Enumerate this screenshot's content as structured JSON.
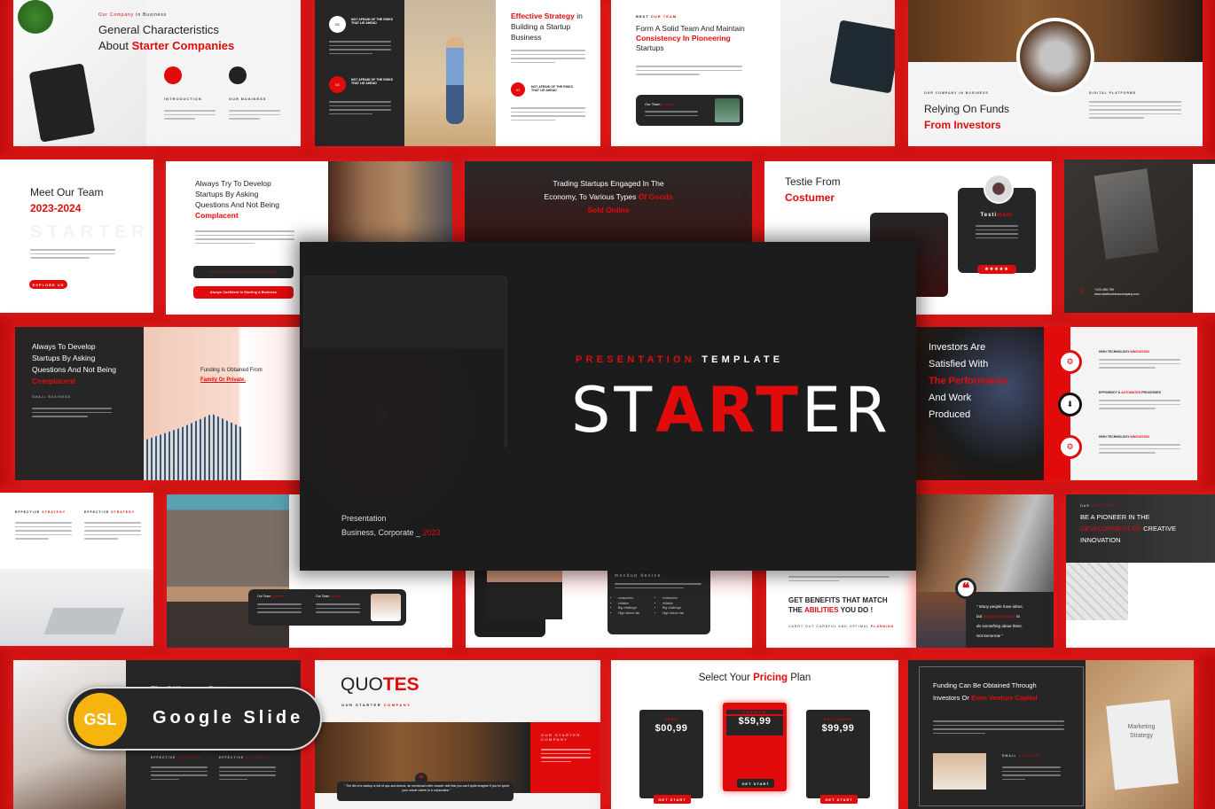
{
  "colors": {
    "accent": "#e10b0b",
    "dark": "#262626",
    "badge": "#f6b40e",
    "background": "#c00d0d"
  },
  "hero": {
    "subtitle_red": "PRESENTATION",
    "subtitle_white": "TEMPLATE",
    "title_part1": "ST",
    "title_part2": "ART",
    "title_part3": "ER",
    "footer_line1": "Presentation",
    "footer_line2": "Business, Corporate _",
    "footer_year": "2023"
  },
  "badge": {
    "short": "GSL",
    "label": "Google Slide"
  },
  "slides": {
    "general": {
      "kicker_red": "Our Company",
      "kicker": "In Business",
      "title1": "General Characteristics",
      "title2_dark": "About",
      "title2_red": "Starter Companies",
      "col1": "INTRODUCTION",
      "col2": "OUR BUSINESS"
    },
    "strategy": {
      "item_a": "02",
      "item_b": "03",
      "item_c": "01",
      "item_label": "NOT AFRAID OF THE RISKS THAT LIE AHEAD",
      "title_red": "Effective Strategy",
      "title_rest": "in",
      "title2": "Building a Startup",
      "title3": "Business"
    },
    "team_form": {
      "kicker_dark": "BEST",
      "kicker_red": "OUR TEAM",
      "title1": "Form A Solid Team And Maintain",
      "title2": "Consistency In Pioneering",
      "title3": "Startups",
      "card_title": "Our Team",
      "card_title_red": "Founder"
    },
    "relying": {
      "kicker": "OUR COMPANY IN BUSINESS",
      "title1": "Relying On Funds",
      "title2": "From Investors",
      "side": "DIGITAL PLATFORMS"
    },
    "meet": {
      "title": "Meet Our Team",
      "years": "2023-2024",
      "watermark": "STARTER",
      "button": "EXPLORE US"
    },
    "always": {
      "l1": "Always Try To Develop",
      "l2": "Startups By Asking",
      "l3": "Questions And Not Being",
      "l4": "Complacent",
      "btn1": "Discipline And Confidence In A Business",
      "btn2": "Always Confident In Starting A Business"
    },
    "trading": {
      "l1": "Trading Startups Engaged In The",
      "l2a": "Economy, To Various Types",
      "l2b": "Of Goods",
      "l3": "Sold Online"
    },
    "testie": {
      "title1": "Testie From",
      "title2": "Costumer",
      "card_a": "Testi",
      "card_b": "moni",
      "stars": "★★★★★"
    },
    "contact": {
      "phone": "+123-456-789",
      "web": "www.startbusinesscompany.com"
    },
    "always_dark": {
      "l1": "Always To Develop",
      "l2": "Startups By Asking",
      "l3": "Questions And Not Being",
      "l4": "Complacent",
      "kicker": "SMALL BUSINESS",
      "right1": "Funding Is Obtained From",
      "right2": "Family Or Private."
    },
    "investors": {
      "l1": "Investors Are",
      "l2": "Satisfied With",
      "l3": "The Performance",
      "l4": "And Work",
      "l5": "Produced",
      "item1": "HIGH TECHNOLOGY",
      "item1_red": "INNOVATION",
      "item2": "EFFICIENCY &",
      "item2_red": "AUTOMATED",
      "item2_rest": "PROCESSES",
      "item3": "HIGH TECHNOLOGY",
      "item3_red": "INNOVATION"
    },
    "effective": {
      "h": "EFFECTIVE",
      "h_red": "STRATEGY"
    },
    "street": {
      "card1": "Our Team",
      "card2": "Our Team",
      "red": "Founder"
    },
    "mockup": {
      "kicker": "mockup device",
      "bullets_a": [
        "consumers",
        "Inflation",
        "Big challenge",
        "High failure risk"
      ],
      "bullets_b": [
        "consumers",
        "Inflation",
        "Big challenge",
        "High failure risk"
      ]
    },
    "benefits": {
      "l1": "GET BENEFITS THAT MATCH",
      "l2a": "THE",
      "l2b": "ABILITIES",
      "l2c": "YOU DO !",
      "sub": "CARRY OUT CAREFUL AND OPTIMAL",
      "sub_red": "PLANNING"
    },
    "quote_coffee": {
      "q1": "\" Many people have ideas,",
      "q2a": "but",
      "q2b": "few people decide",
      "q2c": "to",
      "q3": "do something about them.",
      "q4": "Not tomorrow \""
    },
    "pioneer": {
      "kicker": "OUR",
      "kicker_red": "PORTFOLIO",
      "l1": "BE A PIONEER IN THE",
      "l2_red": "DEVELOPMENT OF",
      "l2": "CREATIVE",
      "l3": "INNOVATION"
    },
    "difference": {
      "title": "The Difference Between",
      "h": "EFFECTIVE",
      "h_red": "STRATEGY"
    },
    "quotes": {
      "title_dark": "QUO",
      "title_red": "TES",
      "sub_dark": "OUR STARTER",
      "sub_red": "COMPANY",
      "box_title": "OUR STARTER COMPANY",
      "quote": "\" The life of a startup is full of ups and downs, an emotional roller coaster ride that you can't quite imagine if you've spent your whole career in a corporation \""
    },
    "pricing": {
      "title_a": "Select Your",
      "title_red": "Pricing",
      "title_b": "Plan",
      "plans": [
        {
          "name": "FREE",
          "price": "$00,99",
          "cta": "GET START"
        },
        {
          "name": "PREMIUM",
          "price": "$59,99",
          "cta": "GET START"
        },
        {
          "name": "EXCLUSIVE",
          "price": "$99,99",
          "cta": "GET START"
        }
      ]
    },
    "funding": {
      "l1": "Funding Can Be Obtained Through",
      "l2a": "Investors Or",
      "l2b": "Even Venture Capital",
      "small": "SMALL",
      "small_red": "BUSINESS",
      "note1": "Marketing",
      "note2": "Strategy"
    }
  }
}
